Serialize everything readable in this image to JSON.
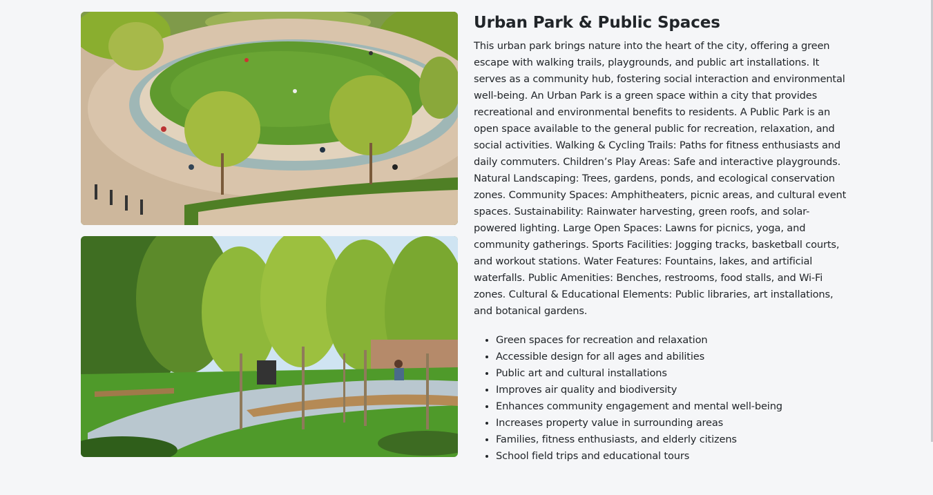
{
  "section": {
    "title": "Urban Park & Public Spaces",
    "description": "This urban park brings nature into the heart of the city, offering a green escape with walking trails, playgrounds, and public art installations. It serves as a community hub, fostering social interaction and environmental well-being. An Urban Park is a green space within a city that provides recreational and environmental benefits to residents. A Public Park is an open space available to the general public for recreation, relaxation, and social activities. Walking & Cycling Trails: Paths for fitness enthusiasts and daily commuters. Children’s Play Areas: Safe and interactive playgrounds. Natural Landscaping: Trees, gardens, ponds, and ecological conservation zones. Community Spaces: Amphitheaters, picnic areas, and cultural event spaces. Sustainability: Rainwater harvesting, green roofs, and solar-powered lighting. Large Open Spaces: Lawns for picnics, yoga, and community gatherings. Sports Facilities: Jogging tracks, basketball courts, and workout stations. Water Features: Fountains, lakes, and artificial waterfalls. Public Amenities: Benches, restrooms, food stalls, and Wi-Fi zones. Cultural & Educational Elements: Public libraries, art installations, and botanical gardens.",
    "features": [
      "Green spaces for recreation and relaxation",
      "Accessible design for all ages and abilities",
      "Public art and cultural installations",
      "Improves air quality and biodiversity",
      "Enhances community engagement and mental well-being",
      "Increases property value in surrounding areas",
      "Families, fitness enthusiasts, and elderly citizens",
      "School field trips and educational tours"
    ]
  },
  "images": {
    "colors": {
      "lawn": "#5f9a2e",
      "plaza": "#d9c4ab",
      "water": "#9fb7b6",
      "foliage": "#8aae2f",
      "sky": "#cfe4f2",
      "path": "#b9c7cf",
      "bench": "#b58a55"
    }
  }
}
